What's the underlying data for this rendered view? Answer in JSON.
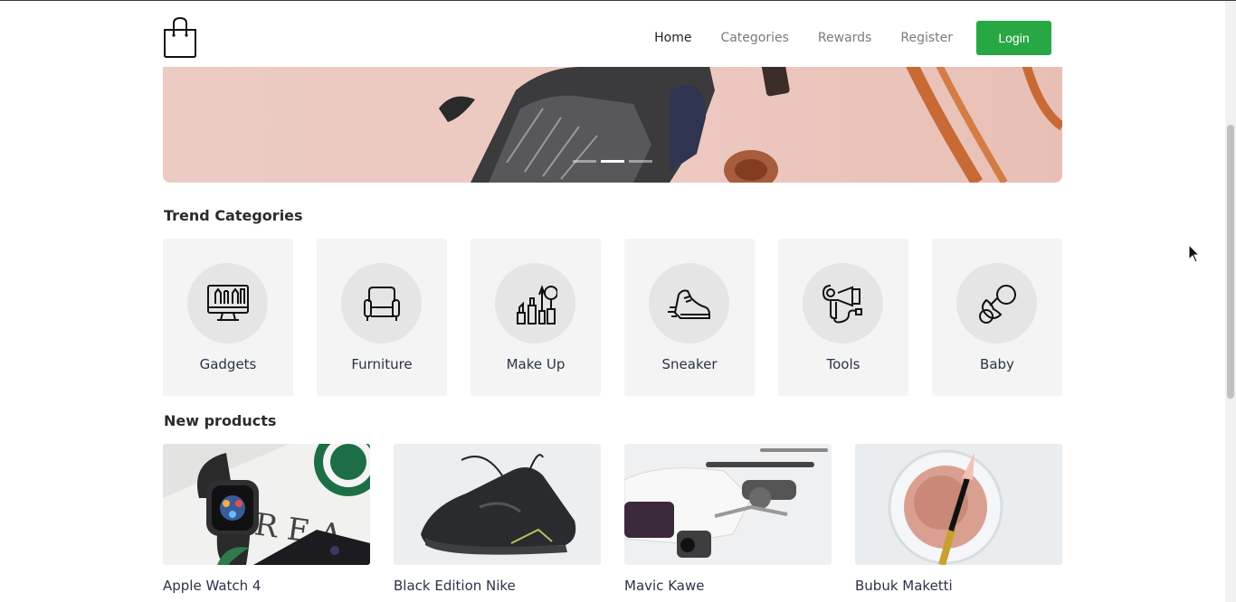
{
  "brand": {
    "logo_icon": "shopping-bag-icon"
  },
  "nav": {
    "links": [
      {
        "label": "Home",
        "active": true
      },
      {
        "label": "Categories",
        "active": false
      },
      {
        "label": "Rewards",
        "active": false
      },
      {
        "label": "Register",
        "active": false
      }
    ],
    "login_label": "Login",
    "accent_color": "#28a745"
  },
  "hero": {
    "image": "sneaker-banner",
    "slide_count": 3,
    "active_slide": 2
  },
  "trend_categories": {
    "title": "Trend Categories",
    "items": [
      {
        "label": "Gadgets",
        "icon": "computer-monitor-icon"
      },
      {
        "label": "Furniture",
        "icon": "armchair-icon"
      },
      {
        "label": "Make Up",
        "icon": "makeup-icon"
      },
      {
        "label": "Sneaker",
        "icon": "sneaker-icon"
      },
      {
        "label": "Tools",
        "icon": "hair-dryer-icon"
      },
      {
        "label": "Baby",
        "icon": "pacifier-icon"
      }
    ]
  },
  "new_products": {
    "title": "New products",
    "items": [
      {
        "name": "Apple Watch 4",
        "image": "apple-watch-photo"
      },
      {
        "name": "Black Edition Nike",
        "image": "nike-shoe-photo"
      },
      {
        "name": "Mavic Kawe",
        "image": "drone-photo"
      },
      {
        "name": "Bubuk Maketti",
        "image": "makeup-powder-photo"
      }
    ]
  }
}
